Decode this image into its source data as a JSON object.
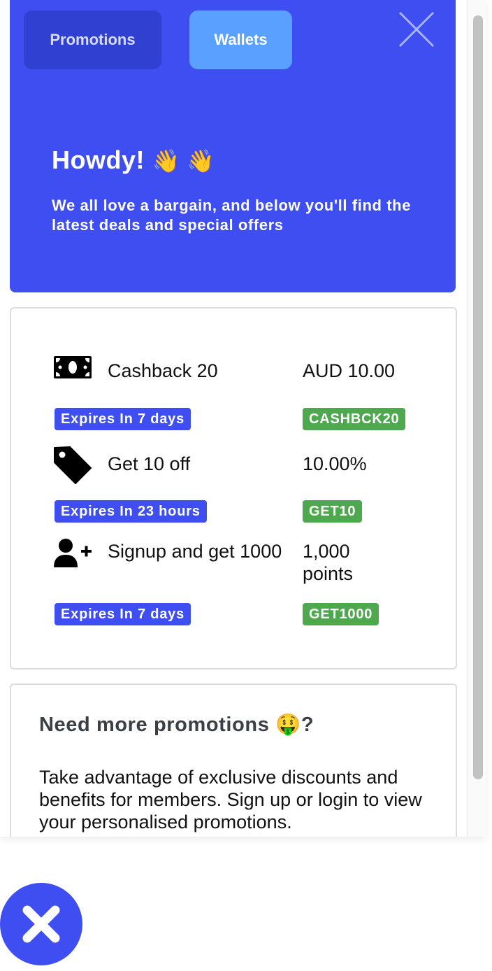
{
  "tabs": [
    {
      "label": "Promotions",
      "active": false
    },
    {
      "label": "Wallets",
      "active": true
    }
  ],
  "hero": {
    "title": "Howdy!",
    "title_emoji": "👋 👋",
    "subtitle": "We all love a bargain, and below you'll find the latest deals and special offers"
  },
  "promotions": [
    {
      "icon": "cash-icon",
      "name": "Cashback 20",
      "value": "AUD 10.00",
      "expiry": "Expires In 7 days",
      "code": "CASHBCK20"
    },
    {
      "icon": "tag-icon",
      "name": "Get 10 off",
      "value": "10.00%",
      "expiry": "Expires In 23 hours",
      "code": "GET10"
    },
    {
      "icon": "user-plus-icon",
      "name": "Signup and get 1000",
      "value": "1,000 points",
      "expiry": "Expires In 7 days",
      "code": "GET1000"
    }
  ],
  "more": {
    "title": "Need more promotions",
    "title_emoji": "🤑",
    "title_suffix": "?",
    "body": "Take advantage of exclusive discounts and benefits for members. Sign up or login to view your personalised promotions."
  },
  "colors": {
    "brand": "#3f4ef0",
    "tab_active": "#5aa0ff",
    "tab_inactive": "#3040d0",
    "code_badge": "#4ea84e"
  },
  "icons": {
    "panel_close": "close-icon",
    "fab_close": "close-icon"
  }
}
